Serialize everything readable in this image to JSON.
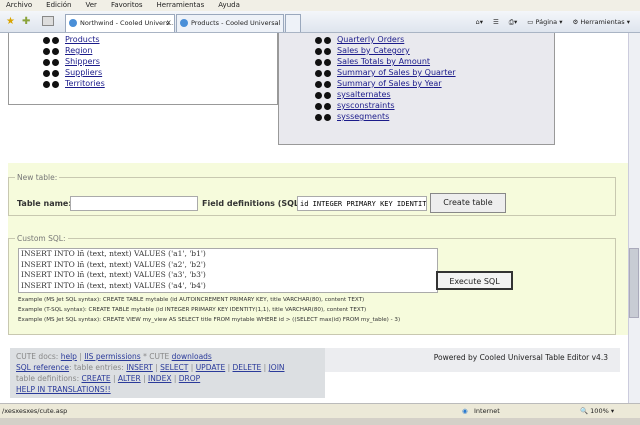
{
  "menu": [
    "Archivo",
    "Edición",
    "Ver",
    "Favoritos",
    "Herramientas",
    "Ayuda"
  ],
  "tabs": [
    {
      "label": "Northwind - Cooled Univers...",
      "close": "X"
    },
    {
      "label": "Products - Cooled Universal ..."
    }
  ],
  "toolbar_right": {
    "page": "Página",
    "tools": "Herramientas"
  },
  "left_tables": [
    "Products",
    "Region",
    "Shippers",
    "Suppliers",
    "Territories"
  ],
  "right_tables": [
    "Quarterly Orders",
    "Sales by Category",
    "Sales Totals by Amount",
    "Summary of Sales by Quarter",
    "Summary of Sales by Year",
    "sysalternates",
    "sysconstraints",
    "syssegments"
  ],
  "new_table": {
    "legend": "New table:",
    "name_label": "Table name:",
    "name_value": "",
    "fields_label": "Field definitions (SQL):",
    "fields_value": "id INTEGER PRIMARY KEY IDENTITY",
    "button": "Create table"
  },
  "custom_sql": {
    "legend": "Custom SQL:",
    "value": "INSERT INTO lñ (text, ntext) VALUES ('a1', 'b1')\nINSERT INTO lñ (text, ntext) VALUES ('a2', 'b2')\nINSERT INTO lñ (text, ntext) VALUES ('a3', 'b3')\nINSERT INTO lñ (text, ntext) VALUES ('a4', 'b4')",
    "button": "Execute SQL",
    "examples": [
      "Example (MS Jet SQL syntax): CREATE TABLE mytable (id AUTOINCREMENT PRIMARY KEY, title VARCHAR(80), content TEXT)",
      "Example (T-SQL syntax): CREATE TABLE mytable (id INTEGER PRIMARY KEY IDENTITY(1,1), title VARCHAR(80), content TEXT)",
      "Example (MS Jet SQL syntax): CREATE VIEW my_view AS SELECT title FROM mytable WHERE id > ((SELECT max(id) FROM my_table) - 3)"
    ]
  },
  "footer": {
    "docs": "CUTE docs:",
    "help": "help",
    "perm": "IIS permissions",
    "cute": "* CUTE",
    "downloads": "downloads",
    "sqlref": "SQL reference",
    "entries": ": table entries:",
    "insert": "INSERT",
    "select": "SELECT",
    "update": "UPDATE",
    "delete": "DELETE",
    "join": "JOIN",
    "defs": "table definitions:",
    "create": "CREATE",
    "alter": "ALTER",
    "index": "INDEX",
    "drop": "DROP",
    "translations": "HELP IN TRANSLATIONS!!",
    "powered": "Powered by Cooled Universal Table Editor v4.3"
  },
  "status": {
    "url": "/xesxesxes/cute.asp",
    "zone": "Internet",
    "zoom": "100%"
  }
}
